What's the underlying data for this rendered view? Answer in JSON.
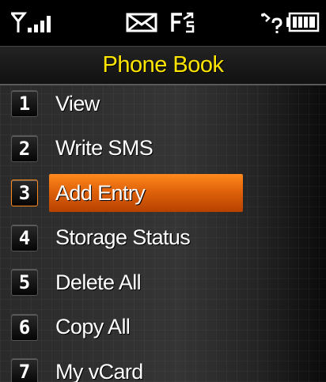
{
  "status_bar": {
    "signal_icon": "signal-strength-icon",
    "message_icon": "envelope-icon",
    "fs_icon": "forward-icon",
    "bluetooth_icon": "bluetooth-icon",
    "battery_icon": "battery-full-icon"
  },
  "title": "Phone Book",
  "menu": {
    "items": [
      {
        "number": "1",
        "label": "View"
      },
      {
        "number": "2",
        "label": "Write SMS"
      },
      {
        "number": "3",
        "label": "Add Entry",
        "selected": true
      },
      {
        "number": "4",
        "label": "Storage Status"
      },
      {
        "number": "5",
        "label": "Delete All"
      },
      {
        "number": "6",
        "label": "Copy All"
      },
      {
        "number": "7",
        "label": "My vCard"
      }
    ]
  },
  "colors": {
    "title": "#ffe600",
    "highlight": "#e0620a",
    "text": "#ffffff",
    "background": "#2a2a2a"
  }
}
